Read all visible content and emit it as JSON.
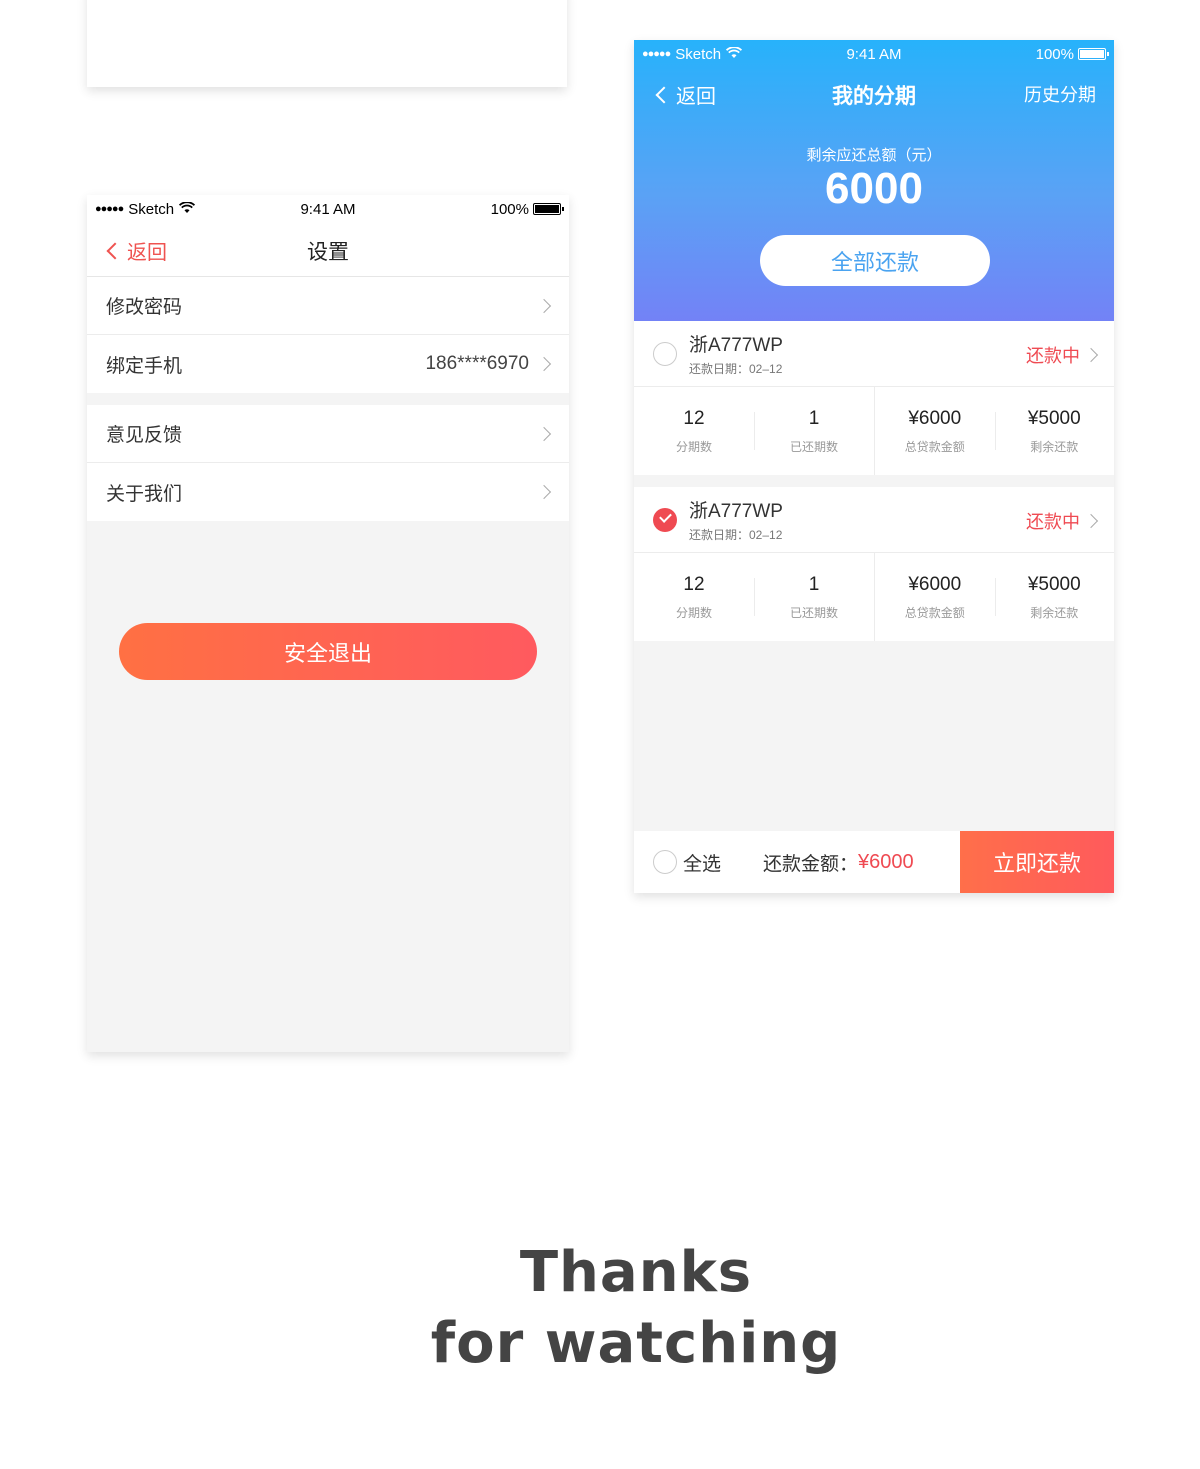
{
  "status_bar": {
    "carrier": "Sketch",
    "time": "9:41 AM",
    "battery": "100%"
  },
  "settings": {
    "back": "返回",
    "title": "设置",
    "group1": [
      {
        "label": "修改密码",
        "value": ""
      },
      {
        "label": "绑定手机",
        "value": "186****6970"
      }
    ],
    "group2": [
      {
        "label": "意见反馈"
      },
      {
        "label": "关于我们"
      }
    ],
    "logout": "安全退出",
    "accent": "#ef5350"
  },
  "installment": {
    "back": "返回",
    "title": "我的分期",
    "history": "历史分期",
    "remain_label": "剩余应还总额（元）",
    "remain_amount": "6000",
    "repay_all": "全部还款",
    "loans": [
      {
        "plate": "浙A777WP",
        "due": "还款日期：02–12",
        "status": "还款中",
        "checked": false,
        "stats": [
          {
            "num": "12",
            "label": "分期数"
          },
          {
            "num": "1",
            "label": "已还期数"
          },
          {
            "num": "¥6000",
            "label": "总贷款金额"
          },
          {
            "num": "¥5000",
            "label": "剩余还款"
          }
        ]
      },
      {
        "plate": "浙A777WP",
        "due": "还款日期：02–12",
        "status": "还款中",
        "checked": true,
        "stats": [
          {
            "num": "12",
            "label": "分期数"
          },
          {
            "num": "1",
            "label": "已还期数"
          },
          {
            "num": "¥6000",
            "label": "总贷款金额"
          },
          {
            "num": "¥5000",
            "label": "剩余还款"
          }
        ]
      }
    ],
    "footer": {
      "select_all": "全选",
      "amount_label": "还款金额：",
      "amount_value": "¥6000",
      "pay_now": "立即还款"
    },
    "header_gradient": [
      "#27b2fb",
      "#7382f6"
    ]
  },
  "thanks": {
    "line1": "Thanks",
    "line2": "for watching"
  }
}
